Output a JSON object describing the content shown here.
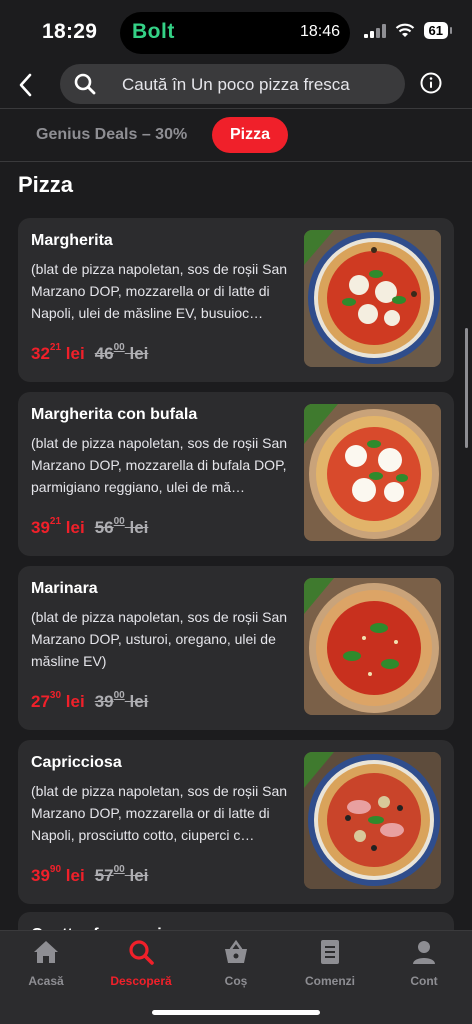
{
  "status": {
    "time": "18:29",
    "island_app": "Bolt",
    "island_time": "18:46",
    "battery": "61"
  },
  "header": {
    "search_placeholder": "Caută în Un poco pizza fresca"
  },
  "tabs": [
    {
      "label": "Genius Deals – 30%"
    },
    {
      "label": "Pizza",
      "active": true
    }
  ],
  "section": {
    "title": "Pizza"
  },
  "items": [
    {
      "name": "Margherita",
      "desc": "(blat de pizza napoletan, sos de roșii San Marzano DOP, mozzarella or di latte di Napoli, ulei de măsline EV, busuioc…",
      "price_int": "32",
      "price_dec": "21",
      "currency": "lei",
      "old_int": "46",
      "old_dec": "00",
      "old_currency": "lei"
    },
    {
      "name": "Margherita con bufala",
      "desc": "(blat de pizza napoletan, sos de roșii San Marzano DOP, mozzarella di bufala DOP, parmigiano reggiano, ulei de mă…",
      "price_int": "39",
      "price_dec": "21",
      "currency": "lei",
      "old_int": "56",
      "old_dec": "00",
      "old_currency": "lei"
    },
    {
      "name": "Marinara",
      "desc": "(blat de pizza napoletan, sos de roșii San Marzano DOP, usturoi, oregano, ulei de măsline EV)",
      "price_int": "27",
      "price_dec": "30",
      "currency": "lei",
      "old_int": "39",
      "old_dec": "00",
      "old_currency": "lei"
    },
    {
      "name": "Capricciosa",
      "desc": "(blat de pizza napoletan, sos de roșii San Marzano DOP, mozzarella or di latte di Napoli, prosciutto cotto, ciuperci c…",
      "price_int": "39",
      "price_dec": "90",
      "currency": "lei",
      "old_int": "57",
      "old_dec": "00",
      "old_currency": "lei"
    }
  ],
  "partial_item": {
    "name": "Quattro formaggi"
  },
  "nav": [
    {
      "label": "Acasă",
      "icon": "home-icon"
    },
    {
      "label": "Descoperă",
      "icon": "search-icon",
      "active": true
    },
    {
      "label": "Coș",
      "icon": "basket-icon"
    },
    {
      "label": "Comenzi",
      "icon": "orders-icon"
    },
    {
      "label": "Cont",
      "icon": "profile-icon"
    }
  ],
  "colors": {
    "accent": "#f0202a",
    "background": "#1c1c1e",
    "card": "#2c2c2e",
    "bolt_green": "#34d186"
  }
}
